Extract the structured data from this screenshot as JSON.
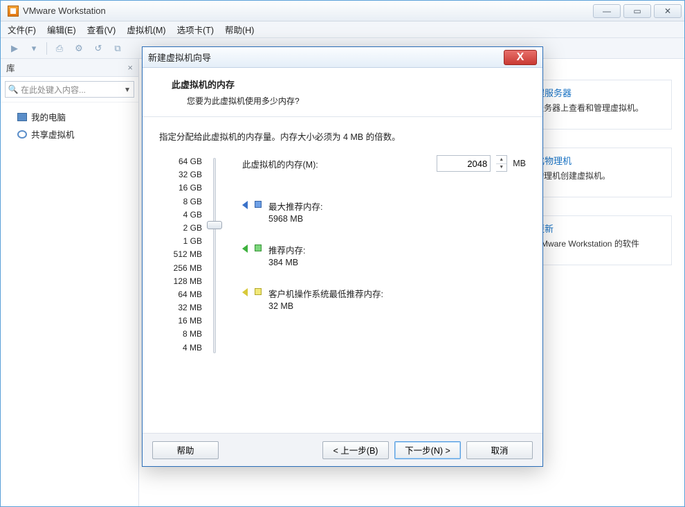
{
  "window": {
    "title": "VMware Workstation"
  },
  "menu": {
    "file": "文件(F)",
    "edit": "编辑(E)",
    "view": "查看(V)",
    "vm": "虚拟机(M)",
    "tabs": "选项卡(T)",
    "help": "帮助(H)"
  },
  "sidebar": {
    "header": "库",
    "search_placeholder": "在此处键入内容...",
    "items": [
      {
        "label": "我的电脑"
      },
      {
        "label": "共享虚拟机"
      }
    ]
  },
  "home_cards": {
    "remote_title": "程服务器",
    "remote_desc": "服务器上查看和管理虚拟机。",
    "phys_title": "化物理机",
    "phys_desc": "物理机创建虚拟机。",
    "update_title": "更新",
    "update_desc": "VMware Workstation 的软件"
  },
  "dialog": {
    "title": "新建虚拟机向导",
    "header_title": "此虚拟机的内存",
    "header_sub": "您要为此虚拟机使用多少内存?",
    "intro": "指定分配给此虚拟机的内存量。内存大小必须为 4 MB 的倍数。",
    "mem_label": "此虚拟机的内存(M):",
    "mem_value": "2048",
    "mem_unit": "MB",
    "ticks": [
      "64 GB",
      "32 GB",
      "16 GB",
      "8 GB",
      "4 GB",
      "2 GB",
      "1 GB",
      "512 MB",
      "256 MB",
      "128 MB",
      "64 MB",
      "32 MB",
      "16 MB",
      "8 MB",
      "4 MB"
    ],
    "rec_max_label": "最大推荐内存:",
    "rec_max_val": "5968 MB",
    "rec_label": "推荐内存:",
    "rec_val": "384 MB",
    "rec_min_label": "客户机操作系统最低推荐内存:",
    "rec_min_val": "32 MB",
    "btn_help": "帮助",
    "btn_back": "< 上一步(B)",
    "btn_next": "下一步(N) >",
    "btn_cancel": "取消"
  }
}
